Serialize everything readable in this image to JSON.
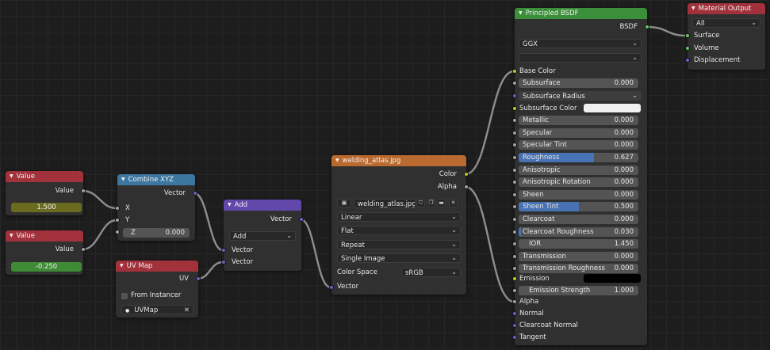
{
  "colors": {
    "value_header": "#a1313b",
    "vector_header": "#3c77a0",
    "vectormath_header": "#6348ab",
    "input_header": "#a1313b",
    "texture_header": "#bb6a2f",
    "shader_header": "#3b8f3b",
    "output_header": "#a1313b",
    "value1_field": "#6b6b1f",
    "value2_field": "#3e8a35",
    "slider_fill": "#4772b3",
    "base_color_swatch": "#f0f0f0",
    "emission_swatch": "#000000"
  },
  "value1": {
    "title": "Value",
    "output": "Value",
    "value": "1.500"
  },
  "value2": {
    "title": "Value",
    "output": "Value",
    "value": "-0.250"
  },
  "combine": {
    "title": "Combine XYZ",
    "output": "Vector",
    "x": "X",
    "y": "Y",
    "z_label": "Z",
    "z_value": "0.000"
  },
  "uvmap": {
    "title": "UV Map",
    "output": "UV",
    "from_instancer": "From Instancer",
    "map_name": "UVMap"
  },
  "add": {
    "title": "Add",
    "output": "Vector",
    "operation": "Add",
    "in1": "Vector",
    "in2": "Vector"
  },
  "image": {
    "title": "welding_atlas.jpg",
    "out_color": "Color",
    "out_alpha": "Alpha",
    "file": "welding_atlas.jpg",
    "interpolation": "Linear",
    "projection": "Flat",
    "extension": "Repeat",
    "source": "Single Image",
    "color_space_label": "Color Space",
    "color_space": "sRGB",
    "in_vector": "Vector",
    "icons": [
      "image-icon",
      "shield-icon",
      "copy-icon",
      "folder-icon",
      "close-icon"
    ]
  },
  "bsdf": {
    "title": "Principled BSDF",
    "output": "BSDF",
    "distribution": "GGX",
    "subsurface_method": "",
    "base_color": "Base Color",
    "subsurface": {
      "label": "Subsurface",
      "value": "0.000"
    },
    "subsurface_radius": "Subsurface Radius",
    "subsurface_color": "Subsurface Color",
    "metallic": {
      "label": "Metallic",
      "value": "0.000"
    },
    "specular": {
      "label": "Specular",
      "value": "0.000"
    },
    "specular_tint": {
      "label": "Specular Tint",
      "value": "0.000"
    },
    "roughness": {
      "label": "Roughness",
      "value": "0.627",
      "fraction": 0.627
    },
    "anisotropic": {
      "label": "Anisotropic",
      "value": "0.000"
    },
    "anisotropic_rotation": {
      "label": "Anisotropic Rotation",
      "value": "0.000"
    },
    "sheen": {
      "label": "Sheen",
      "value": "0.000"
    },
    "sheen_tint": {
      "label": "Sheen Tint",
      "value": "0.500",
      "fraction": 0.5
    },
    "clearcoat": {
      "label": "Clearcoat",
      "value": "0.000"
    },
    "clearcoat_roughness": {
      "label": "Clearcoat Roughness",
      "value": "0.030",
      "fraction": 0.03
    },
    "ior": {
      "label": "IOR",
      "value": "1.450"
    },
    "transmission": {
      "label": "Transmission",
      "value": "0.000"
    },
    "transmission_roughness": {
      "label": "Transmission Roughness",
      "value": "0.000"
    },
    "emission": "Emission",
    "emission_strength": {
      "label": "Emission Strength",
      "value": "1.000"
    },
    "alpha": "Alpha",
    "normal": "Normal",
    "clearcoat_normal": "Clearcoat Normal",
    "tangent": "Tangent"
  },
  "output": {
    "title": "Material Output",
    "target": "All",
    "surface": "Surface",
    "volume": "Volume",
    "displacement": "Displacement"
  }
}
